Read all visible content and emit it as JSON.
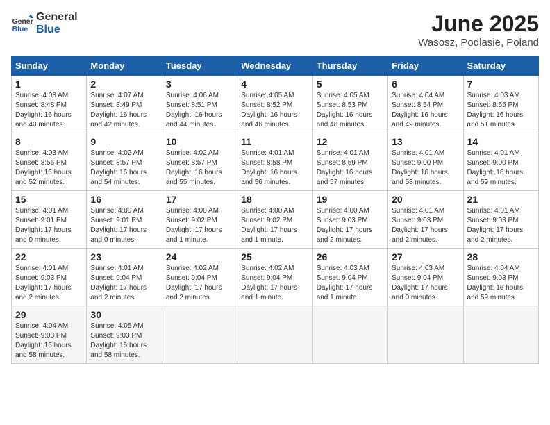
{
  "logo": {
    "line1": "General",
    "line2": "Blue"
  },
  "title": "June 2025",
  "subtitle": "Wasosz, Podlasie, Poland",
  "days_of_week": [
    "Sunday",
    "Monday",
    "Tuesday",
    "Wednesday",
    "Thursday",
    "Friday",
    "Saturday"
  ],
  "weeks": [
    [
      {
        "day": 1,
        "info": "Sunrise: 4:08 AM\nSunset: 8:48 PM\nDaylight: 16 hours\nand 40 minutes."
      },
      {
        "day": 2,
        "info": "Sunrise: 4:07 AM\nSunset: 8:49 PM\nDaylight: 16 hours\nand 42 minutes."
      },
      {
        "day": 3,
        "info": "Sunrise: 4:06 AM\nSunset: 8:51 PM\nDaylight: 16 hours\nand 44 minutes."
      },
      {
        "day": 4,
        "info": "Sunrise: 4:05 AM\nSunset: 8:52 PM\nDaylight: 16 hours\nand 46 minutes."
      },
      {
        "day": 5,
        "info": "Sunrise: 4:05 AM\nSunset: 8:53 PM\nDaylight: 16 hours\nand 48 minutes."
      },
      {
        "day": 6,
        "info": "Sunrise: 4:04 AM\nSunset: 8:54 PM\nDaylight: 16 hours\nand 49 minutes."
      },
      {
        "day": 7,
        "info": "Sunrise: 4:03 AM\nSunset: 8:55 PM\nDaylight: 16 hours\nand 51 minutes."
      }
    ],
    [
      {
        "day": 8,
        "info": "Sunrise: 4:03 AM\nSunset: 8:56 PM\nDaylight: 16 hours\nand 52 minutes."
      },
      {
        "day": 9,
        "info": "Sunrise: 4:02 AM\nSunset: 8:57 PM\nDaylight: 16 hours\nand 54 minutes."
      },
      {
        "day": 10,
        "info": "Sunrise: 4:02 AM\nSunset: 8:57 PM\nDaylight: 16 hours\nand 55 minutes."
      },
      {
        "day": 11,
        "info": "Sunrise: 4:01 AM\nSunset: 8:58 PM\nDaylight: 16 hours\nand 56 minutes."
      },
      {
        "day": 12,
        "info": "Sunrise: 4:01 AM\nSunset: 8:59 PM\nDaylight: 16 hours\nand 57 minutes."
      },
      {
        "day": 13,
        "info": "Sunrise: 4:01 AM\nSunset: 9:00 PM\nDaylight: 16 hours\nand 58 minutes."
      },
      {
        "day": 14,
        "info": "Sunrise: 4:01 AM\nSunset: 9:00 PM\nDaylight: 16 hours\nand 59 minutes."
      }
    ],
    [
      {
        "day": 15,
        "info": "Sunrise: 4:01 AM\nSunset: 9:01 PM\nDaylight: 17 hours\nand 0 minutes."
      },
      {
        "day": 16,
        "info": "Sunrise: 4:00 AM\nSunset: 9:01 PM\nDaylight: 17 hours\nand 0 minutes."
      },
      {
        "day": 17,
        "info": "Sunrise: 4:00 AM\nSunset: 9:02 PM\nDaylight: 17 hours\nand 1 minute."
      },
      {
        "day": 18,
        "info": "Sunrise: 4:00 AM\nSunset: 9:02 PM\nDaylight: 17 hours\nand 1 minute."
      },
      {
        "day": 19,
        "info": "Sunrise: 4:00 AM\nSunset: 9:03 PM\nDaylight: 17 hours\nand 2 minutes."
      },
      {
        "day": 20,
        "info": "Sunrise: 4:01 AM\nSunset: 9:03 PM\nDaylight: 17 hours\nand 2 minutes."
      },
      {
        "day": 21,
        "info": "Sunrise: 4:01 AM\nSunset: 9:03 PM\nDaylight: 17 hours\nand 2 minutes."
      }
    ],
    [
      {
        "day": 22,
        "info": "Sunrise: 4:01 AM\nSunset: 9:03 PM\nDaylight: 17 hours\nand 2 minutes."
      },
      {
        "day": 23,
        "info": "Sunrise: 4:01 AM\nSunset: 9:04 PM\nDaylight: 17 hours\nand 2 minutes."
      },
      {
        "day": 24,
        "info": "Sunrise: 4:02 AM\nSunset: 9:04 PM\nDaylight: 17 hours\nand 2 minutes."
      },
      {
        "day": 25,
        "info": "Sunrise: 4:02 AM\nSunset: 9:04 PM\nDaylight: 17 hours\nand 1 minute."
      },
      {
        "day": 26,
        "info": "Sunrise: 4:03 AM\nSunset: 9:04 PM\nDaylight: 17 hours\nand 1 minute."
      },
      {
        "day": 27,
        "info": "Sunrise: 4:03 AM\nSunset: 9:04 PM\nDaylight: 17 hours\nand 0 minutes."
      },
      {
        "day": 28,
        "info": "Sunrise: 4:04 AM\nSunset: 9:03 PM\nDaylight: 16 hours\nand 59 minutes."
      }
    ],
    [
      {
        "day": 29,
        "info": "Sunrise: 4:04 AM\nSunset: 9:03 PM\nDaylight: 16 hours\nand 58 minutes."
      },
      {
        "day": 30,
        "info": "Sunrise: 4:05 AM\nSunset: 9:03 PM\nDaylight: 16 hours\nand 58 minutes."
      },
      null,
      null,
      null,
      null,
      null
    ]
  ]
}
